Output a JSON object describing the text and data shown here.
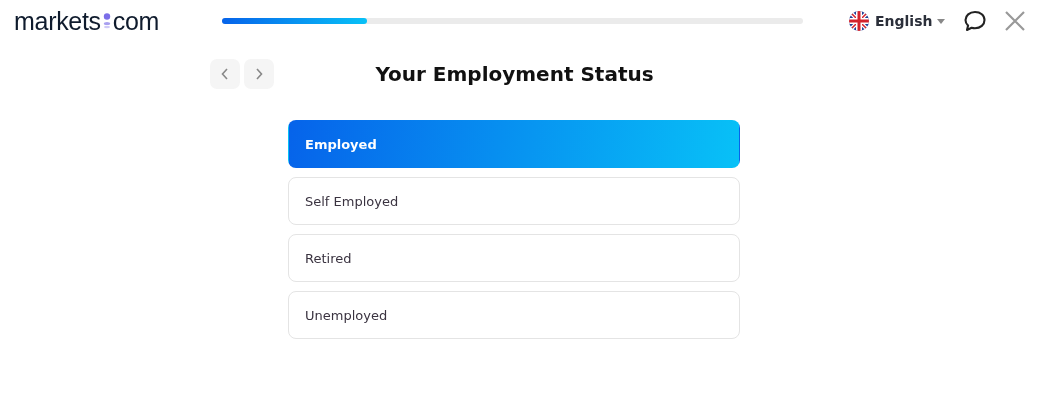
{
  "header": {
    "logo": {
      "left": "markets",
      "right": "com"
    },
    "progress": {
      "level": 0.25
    },
    "language": "English"
  },
  "title": "Your Employment Status",
  "options": [
    {
      "label": "Employed",
      "selected": true
    },
    {
      "label": "Self Employed",
      "selected": false
    },
    {
      "label": "Retired",
      "selected": false
    },
    {
      "label": "Unemployed",
      "selected": false
    }
  ]
}
